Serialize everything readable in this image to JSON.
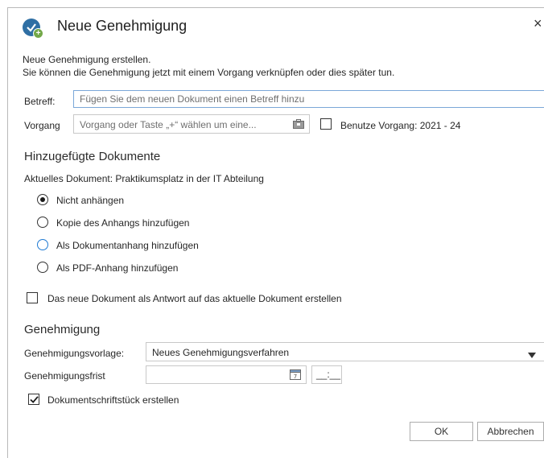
{
  "dialog": {
    "title": "Neue Genehmigung",
    "close_label": "×",
    "description_line1": "Neue Genehmigung erstellen.",
    "description_line2": "Sie können die Genehmigung jetzt mit einem Vorgang verknüpfen oder dies später tun."
  },
  "form": {
    "subject_label": "Betreff:",
    "subject_placeholder": "Fügen Sie dem neuen Dokument einen Betreff hinzu",
    "process_label": "Vorgang",
    "process_placeholder": "Vorgang oder Taste „+“ wählen um eine...",
    "use_process_label": "Benutze Vorgang: 2021 - 24",
    "use_process_checked": false
  },
  "documents": {
    "heading": "Hinzugefügte Dokumente",
    "current_document": "Aktuelles Dokument: Praktikumsplatz in der IT Abteilung",
    "options": [
      {
        "label": "Nicht anhängen",
        "selected": true
      },
      {
        "label": "Kopie des Anhangs hinzufügen",
        "selected": false
      },
      {
        "label": "Als Dokumentanhang hinzufügen",
        "selected": false
      },
      {
        "label": "Als PDF-Anhang hinzufügen",
        "selected": false
      }
    ],
    "reply_label": "Das neue Dokument als Antwort auf das aktuelle Dokument erstellen",
    "reply_checked": false
  },
  "approval": {
    "heading": "Genehmigung",
    "template_label": "Genehmigungsvorlage:",
    "template_value": "Neues Genehmigungsverfahren",
    "deadline_label": "Genehmigungsfrist",
    "deadline_date": "",
    "deadline_time": "__:__",
    "create_document_label": "Dokumentschriftstück erstellen",
    "create_document_checked": true
  },
  "buttons": {
    "ok": "OK",
    "cancel": "Abbrechen"
  },
  "colors": {
    "focus_border": "#7aa7d8",
    "icon_blue": "#2f6fa4",
    "icon_green": "#73a849"
  }
}
